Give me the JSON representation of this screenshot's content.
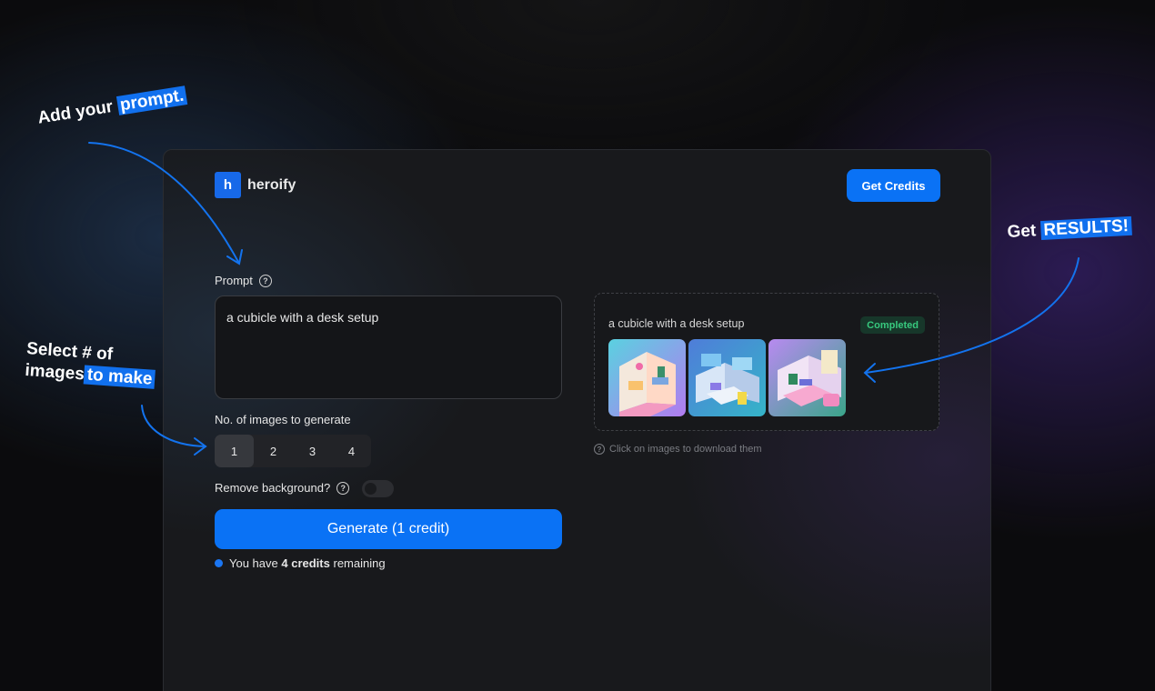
{
  "annotations": {
    "prompt_pre": "Add your",
    "prompt_hl": "prompt.",
    "select_line1": "Select # of",
    "select_line2_pre": "images",
    "select_line2_hl": "to make",
    "results_pre": "Get",
    "results_hl": "RESULTS!"
  },
  "header": {
    "logo_letter": "h",
    "brand": "heroify",
    "get_credits_label": "Get Credits"
  },
  "form": {
    "prompt_label": "Prompt",
    "prompt_value": "a cubicle with a desk setup",
    "count_label": "No. of images to generate",
    "count_options": [
      "1",
      "2",
      "3",
      "4"
    ],
    "count_selected": "1",
    "remove_bg_label": "Remove background?",
    "remove_bg_enabled": false,
    "generate_label": "Generate (1 credit)",
    "credits_prefix": "You have",
    "credits_amount": "4 credits",
    "credits_suffix": "remaining"
  },
  "result": {
    "title": "a cubicle with a desk setup",
    "status": "Completed",
    "hint": "Click on images to download them"
  },
  "colors": {
    "accent": "#0a72f5",
    "status_bg": "#17372a",
    "status_text": "#37c97e"
  },
  "icons": [
    "help-circle-icon",
    "arrow-icon"
  ]
}
